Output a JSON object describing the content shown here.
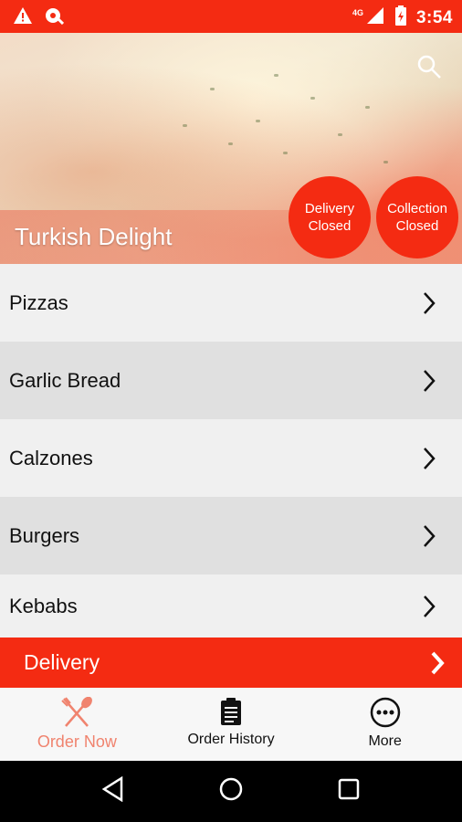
{
  "status_bar": {
    "time": "3:54",
    "network": "4G",
    "icons": [
      "alert-icon",
      "location-icon",
      "signal-icon",
      "battery-icon"
    ]
  },
  "header": {
    "restaurant_name": "Turkish Delight",
    "search_icon": "search-icon",
    "delivery_status": {
      "line1": "Delivery",
      "line2": "Closed"
    },
    "collection_status": {
      "line1": "Collection",
      "line2": "Closed"
    }
  },
  "menu": {
    "items": [
      {
        "label": "Pizzas"
      },
      {
        "label": "Garlic Bread"
      },
      {
        "label": "Calzones"
      },
      {
        "label": "Burgers"
      },
      {
        "label": "Kebabs"
      }
    ]
  },
  "delivery_bar": {
    "label": "Delivery"
  },
  "tabs": [
    {
      "label": "Order Now",
      "icon": "fork-knife-icon",
      "active": true
    },
    {
      "label": "Order History",
      "icon": "clipboard-icon",
      "active": false
    },
    {
      "label": "More",
      "icon": "more-icon",
      "active": false
    }
  ],
  "colors": {
    "accent": "#f42b12",
    "active_tab": "#f0836e",
    "row_light": "#f0f0f0",
    "row_dark": "#e0e0e0"
  }
}
